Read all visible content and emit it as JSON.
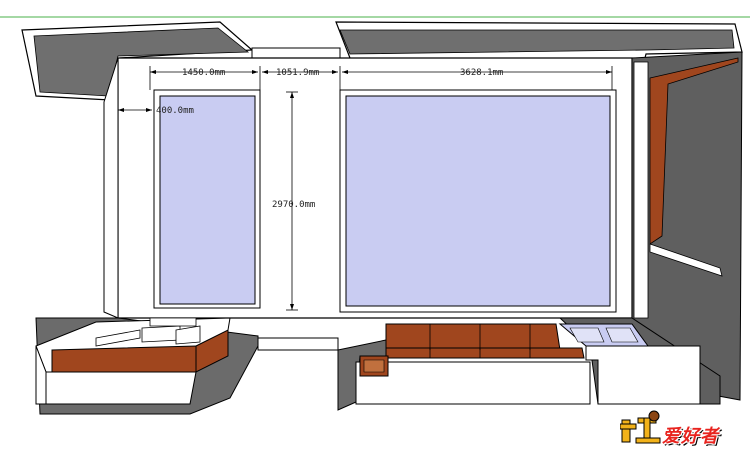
{
  "dimensions": {
    "left_window_width": "1450.0mm",
    "pier_width": "1051.9mm",
    "right_window_width": "3628.1mm",
    "wall_offset": "400.0mm",
    "window_height": "2970.0mm"
  },
  "watermark": {
    "text": "爱好者",
    "mark": "木工"
  },
  "colors": {
    "glass": "#c9ccf2",
    "wood": "#a0461e",
    "wall_shadow": "#6b6b6b",
    "wall_face": "#ffffff"
  }
}
